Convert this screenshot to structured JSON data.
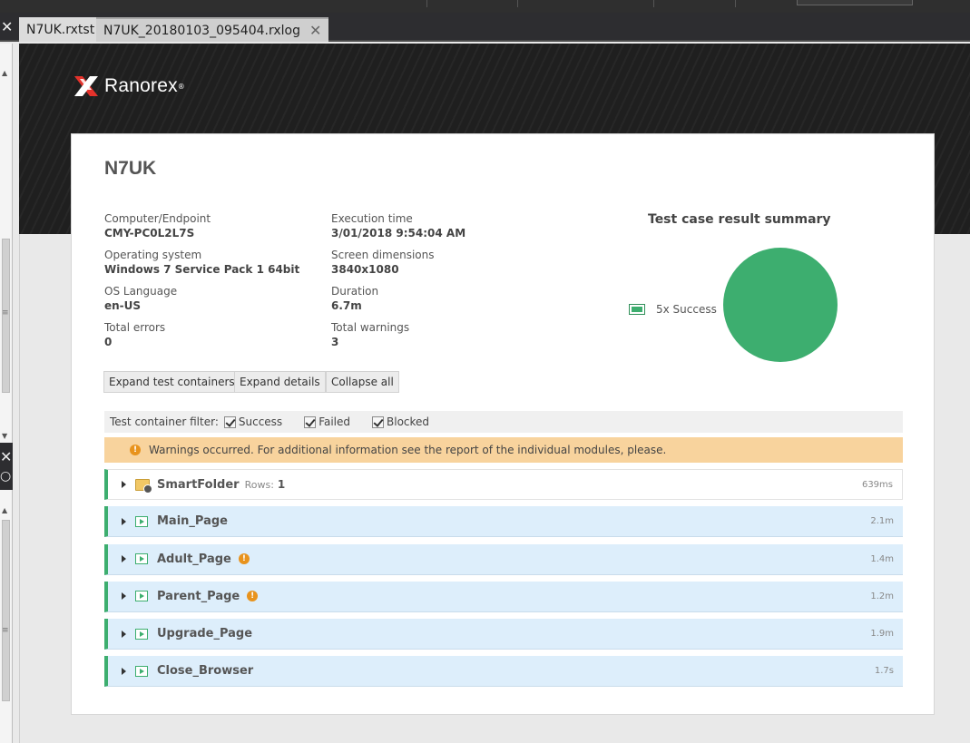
{
  "tabs": [
    {
      "label": "N7UK.rxtst"
    },
    {
      "label": "N7UK_20180103_095404.rxlog"
    }
  ],
  "brand": {
    "name": "Ranorex",
    "tm": "®"
  },
  "report": {
    "title": "N7UK",
    "info": [
      {
        "label": "Computer/Endpoint",
        "value": "CMY-PC0L2L7S"
      },
      {
        "label": "Execution time",
        "value": "3/01/2018 9:54:04 AM"
      },
      {
        "label": "Operating system",
        "value": "Windows 7 Service Pack 1 64bit"
      },
      {
        "label": "Screen dimensions",
        "value": "3840x1080"
      },
      {
        "label": "OS Language",
        "value": "en-US"
      },
      {
        "label": "Duration",
        "value": "6.7m"
      },
      {
        "label": "Total errors",
        "value": "0"
      },
      {
        "label": "Total warnings",
        "value": "3"
      }
    ],
    "summary_title": "Test case result summary",
    "buttons": {
      "expand_containers": "Expand test containers",
      "expand_details": "Expand details",
      "collapse_all": "Collapse all"
    },
    "filter": {
      "label": "Test container filter:",
      "success": "Success",
      "failed": "Failed",
      "blocked": "Blocked"
    },
    "warning_text": "Warnings occurred. For additional information see the report of the individual modules, please.",
    "rows": [
      {
        "name": "SmartFolder",
        "rows_label": "Rows:",
        "rows_value": "1",
        "duration": "639ms"
      },
      {
        "name": "Main_Page",
        "duration": "2.1m"
      },
      {
        "name": "Adult_Page",
        "duration": "1.4m"
      },
      {
        "name": "Parent_Page",
        "duration": "1.2m"
      },
      {
        "name": "Upgrade_Page",
        "duration": "1.9m"
      },
      {
        "name": "Close_Browser",
        "duration": "1.7s"
      }
    ]
  },
  "chart_data": {
    "type": "pie",
    "title": "Test case result summary",
    "categories": [
      "Success"
    ],
    "values": [
      5
    ],
    "legend": [
      "5x Success"
    ],
    "legend_position": "left",
    "colors": [
      "#3dae6f"
    ]
  },
  "colors": {
    "success": "#3dae6f",
    "warning": "#e8931d",
    "warning_bg": "#f8d39d",
    "row_bg": "#ddeefb"
  }
}
